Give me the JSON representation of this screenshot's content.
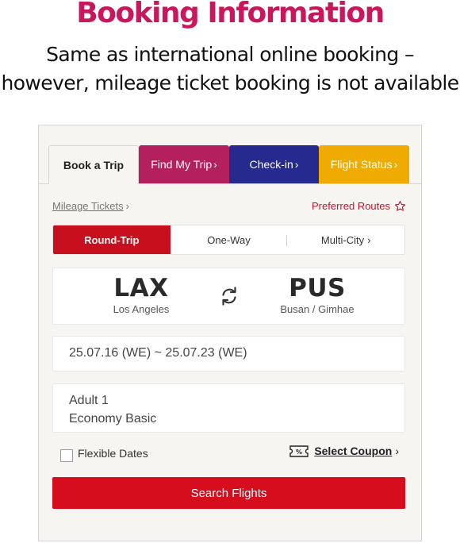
{
  "header": {
    "title": "Booking Information",
    "subtitle_line1": "Same as international online booking –",
    "subtitle_line2": "however, mileage ticket booking is not available"
  },
  "tabs": [
    {
      "label": "Book a Trip",
      "active": true
    },
    {
      "label": "Find My Trip",
      "color": "#b3205d"
    },
    {
      "label": "Check-in",
      "color": "#262a8f"
    },
    {
      "label": "Flight Status",
      "color": "#efab00"
    }
  ],
  "links": {
    "mileage_tickets": "Mileage Tickets",
    "preferred_routes": "Preferred Routes"
  },
  "trip_types": [
    {
      "label": "Round-Trip",
      "selected": true
    },
    {
      "label": "One-Way"
    },
    {
      "label": "Multi-City"
    }
  ],
  "route": {
    "from_code": "LAX",
    "from_city": "Los Angeles",
    "to_code": "PUS",
    "to_city": "Busan / Gimhae"
  },
  "dates": "25.07.16 (WE) ~ 25.07.23 (WE)",
  "passengers": {
    "count_label": "Adult 1",
    "cabin_label": "Economy Basic"
  },
  "options": {
    "flexible_dates": "Flexible Dates",
    "flexible_checked": false,
    "select_coupon": "Select Coupon"
  },
  "search_button": "Search Flights",
  "colors": {
    "headline": "#c8175d",
    "primary_red": "#d50d1c",
    "find_tab": "#b3205d",
    "checkin_tab": "#262a8f",
    "status_tab": "#efab00"
  }
}
